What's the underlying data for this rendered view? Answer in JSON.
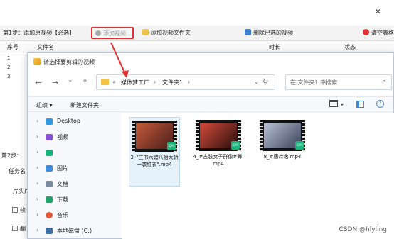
{
  "app": {
    "win_close": "✕",
    "toolbar": {
      "step1": "第1步：添加原视频【必选】",
      "add_video": "添加视频",
      "add_folder": "添加视频文件夹",
      "delete_selected": "删除已选的视频",
      "clear_list": "清空表格"
    },
    "grid": {
      "headers": [
        "序号",
        "文件名",
        "时长",
        "状态"
      ],
      "rows": [
        "1",
        "2",
        "3"
      ]
    },
    "step2": "第2步：",
    "task_label": "任务名",
    "clip_label": "片头片",
    "clip_cut": "帧",
    "effects": "翻"
  },
  "dialog": {
    "title": "请选择要剪辑的视频",
    "nav": {
      "back": "←",
      "forward": "→",
      "down": "⌄",
      "up": "↑"
    },
    "address": {
      "sep": "«",
      "crumbs": [
        "媒体梦工厂",
        "文件夹1"
      ]
    },
    "search_placeholder": "在 文件夹1 中搜索",
    "commands": {
      "organize": "组织 ▾",
      "new_folder": "新建文件夹"
    },
    "sidebar": [
      {
        "label": "Desktop",
        "icon": "desktop-icon",
        "color": "#2f9ae0"
      },
      {
        "label": "视频",
        "icon": "video-icon",
        "color": "#8a4fd4"
      },
      {
        "label": "",
        "icon": "iqiyi-icon",
        "color": "#17b37a"
      },
      {
        "label": "图片",
        "icon": "pictures-icon",
        "color": "#3b8be0"
      },
      {
        "label": "文档",
        "icon": "documents-icon",
        "color": "#7a8aa0"
      },
      {
        "label": "下载",
        "icon": "downloads-icon",
        "color": "#1fa36c"
      },
      {
        "label": "音乐",
        "icon": "music-icon",
        "color": "#e0573b"
      },
      {
        "label": "本地磁盘 (C:)",
        "icon": "drive-icon",
        "color": "#3a6ea5"
      }
    ],
    "files": [
      {
        "name": "3_\"三书六聘八抬大轿一袭红衣\".mp4",
        "color1": "#c45a3a",
        "color2": "#4a1f1a"
      },
      {
        "name": "4_#古装女子群像#舞.mp4",
        "color1": "#d44b3a",
        "color2": "#2a0f0d"
      },
      {
        "name": "8_#唐诗逸.mp4",
        "color1": "#b9c2d6",
        "color2": "#3a4258"
      }
    ],
    "badge_text": "iQIYI"
  },
  "watermark": "CSDN @hlyling",
  "colors": {
    "highlight": "#e03030",
    "accent_blue": "#2f6fd6"
  }
}
